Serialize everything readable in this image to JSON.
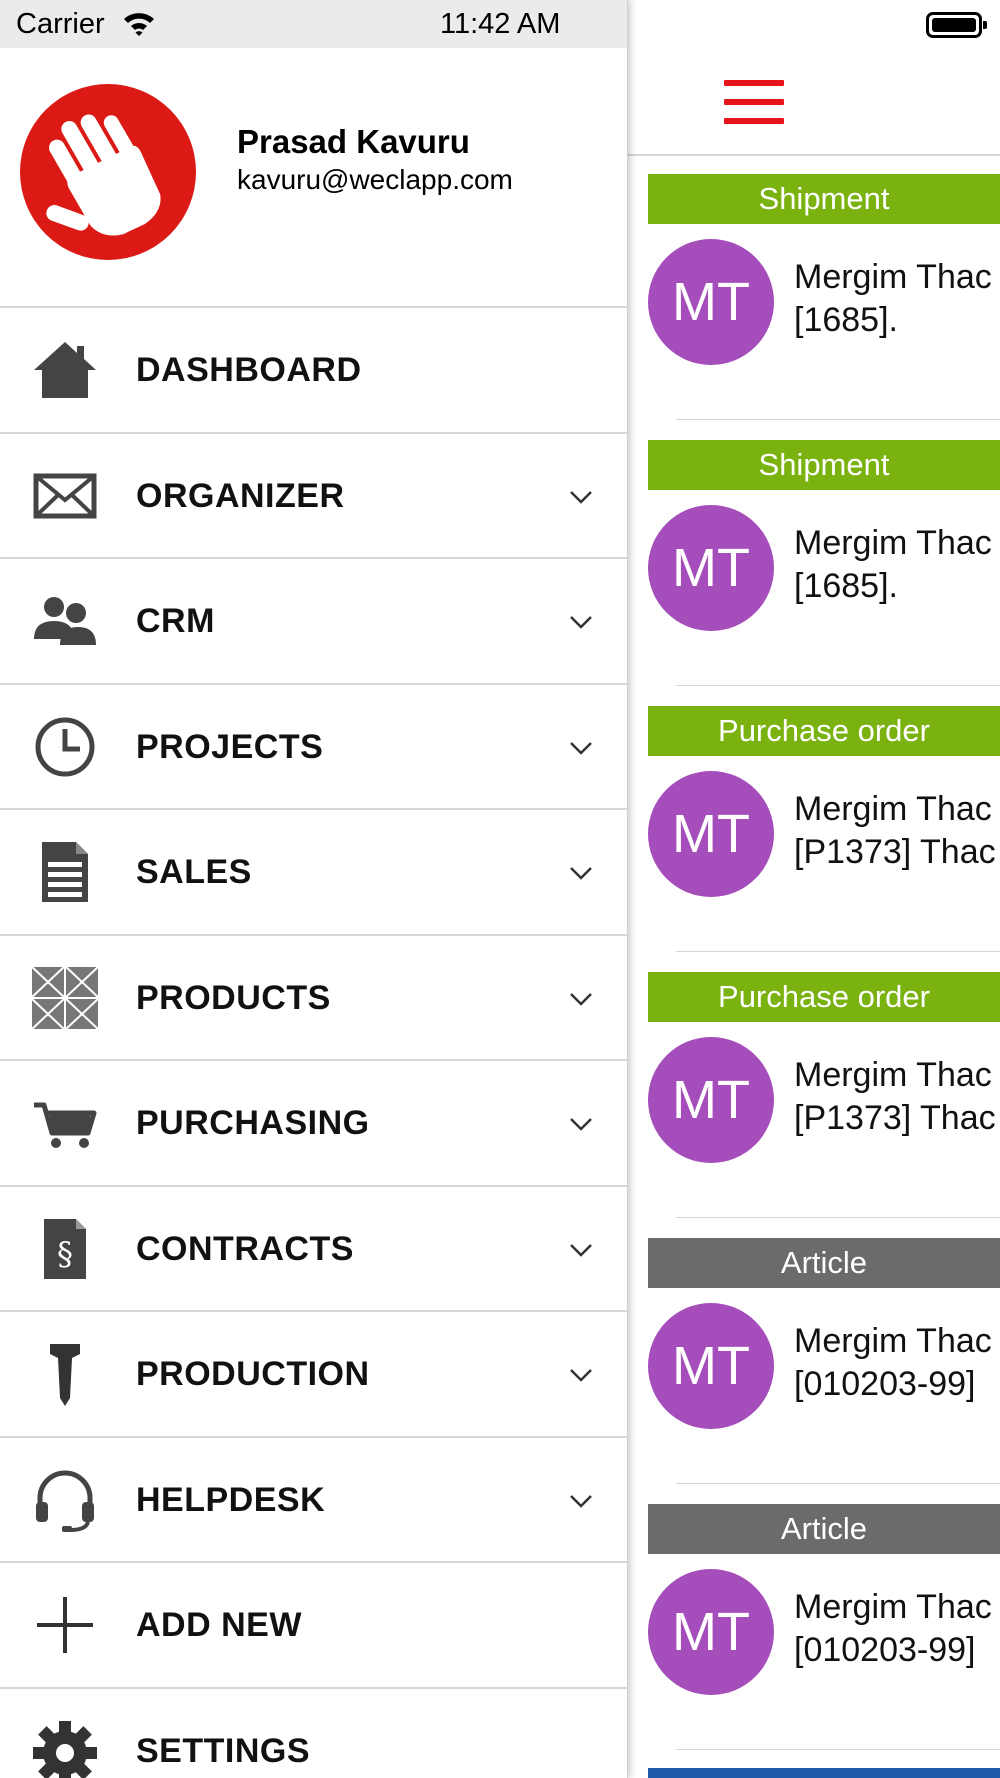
{
  "status_bar": {
    "carrier": "Carrier",
    "time": "11:42 AM"
  },
  "profile": {
    "name": "Prasad Kavuru",
    "email": "kavuru@weclapp.com",
    "logo_color": "#dc1a15"
  },
  "menu": {
    "items": [
      {
        "label": "DASHBOARD",
        "icon": "home-icon",
        "expandable": false
      },
      {
        "label": "ORGANIZER",
        "icon": "envelope-icon",
        "expandable": true
      },
      {
        "label": "CRM",
        "icon": "people-icon",
        "expandable": true
      },
      {
        "label": "PROJECTS",
        "icon": "clock-icon",
        "expandable": true
      },
      {
        "label": "SALES",
        "icon": "document-icon",
        "expandable": true
      },
      {
        "label": "PRODUCTS",
        "icon": "boxes-icon",
        "expandable": true
      },
      {
        "label": "PURCHASING",
        "icon": "cart-icon",
        "expandable": true
      },
      {
        "label": "CONTRACTS",
        "icon": "contract-icon",
        "expandable": true
      },
      {
        "label": "PRODUCTION",
        "icon": "screw-icon",
        "expandable": true
      },
      {
        "label": "HELPDESK",
        "icon": "headset-icon",
        "expandable": true
      },
      {
        "label": "ADD NEW",
        "icon": "plus-icon",
        "expandable": false
      },
      {
        "label": "SETTINGS",
        "icon": "gear-icon",
        "expandable": false
      }
    ]
  },
  "feed": {
    "menu_icon": "hamburger-icon",
    "items": [
      {
        "type": "Shipment",
        "type_color": "#7ab20f",
        "initials": "MT",
        "line1": "Mergim Thac",
        "line2": "[1685]."
      },
      {
        "type": "Shipment",
        "type_color": "#7ab20f",
        "initials": "MT",
        "line1": "Mergim Thac",
        "line2": "[1685]."
      },
      {
        "type": "Purchase order",
        "type_color": "#7ab20f",
        "initials": "MT",
        "line1": "Mergim Thac",
        "line2": "[P1373] Thac"
      },
      {
        "type": "Purchase order",
        "type_color": "#7ab20f",
        "initials": "MT",
        "line1": "Mergim Thac",
        "line2": "[P1373] Thac"
      },
      {
        "type": "Article",
        "type_color": "#6b6b6b",
        "initials": "MT",
        "line1": "Mergim Thac",
        "line2": "[010203-99]"
      },
      {
        "type": "Article",
        "type_color": "#6b6b6b",
        "initials": "MT",
        "line1": "Mergim Thac",
        "line2": "[010203-99]"
      }
    ],
    "avatar_color": "#a54dbb"
  }
}
